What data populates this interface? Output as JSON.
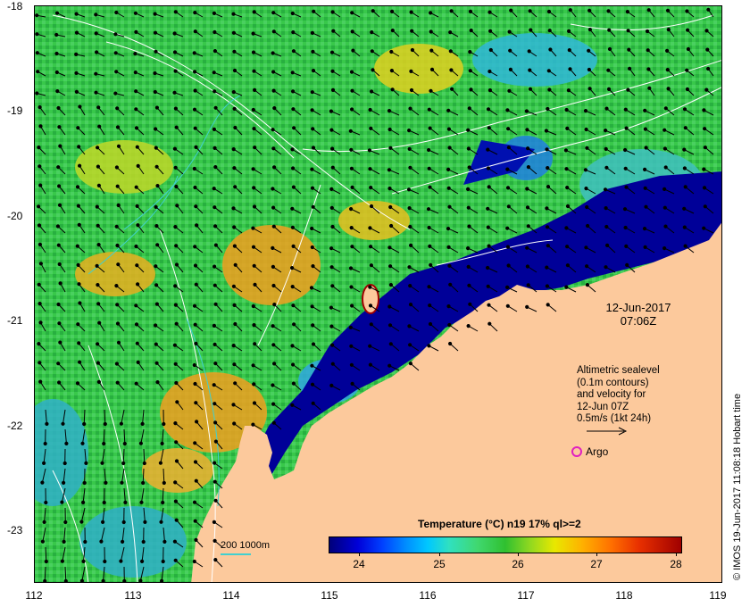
{
  "lat_ticks": [
    "-18",
    "-19",
    "-20",
    "-21",
    "-22",
    "-23"
  ],
  "lon_ticks": [
    "112",
    "113",
    "114",
    "115",
    "116",
    "117",
    "118",
    "119"
  ],
  "date_line1": "12-Jun-2017",
  "date_line2": "07:06Z",
  "legend_lines": [
    "Altimetric sealevel",
    "(0.1m contours)",
    "and velocity for",
    "12-Jun 07Z",
    "0.5m/s (1kt 24h)"
  ],
  "argo_label": "Argo",
  "depth_key": "200  1000m",
  "colorbar_title": "Temperature (°C) n19 17% ql>=2",
  "colorbar_ticks": [
    "24",
    "25",
    "26",
    "27",
    "28"
  ],
  "credit": "© IMOS 19-Jun-2017 11:08:18 Hobart time",
  "colors": {
    "land": "#fcc99c",
    "argo": "#e020c0",
    "isobath": "#40d0d0"
  }
}
